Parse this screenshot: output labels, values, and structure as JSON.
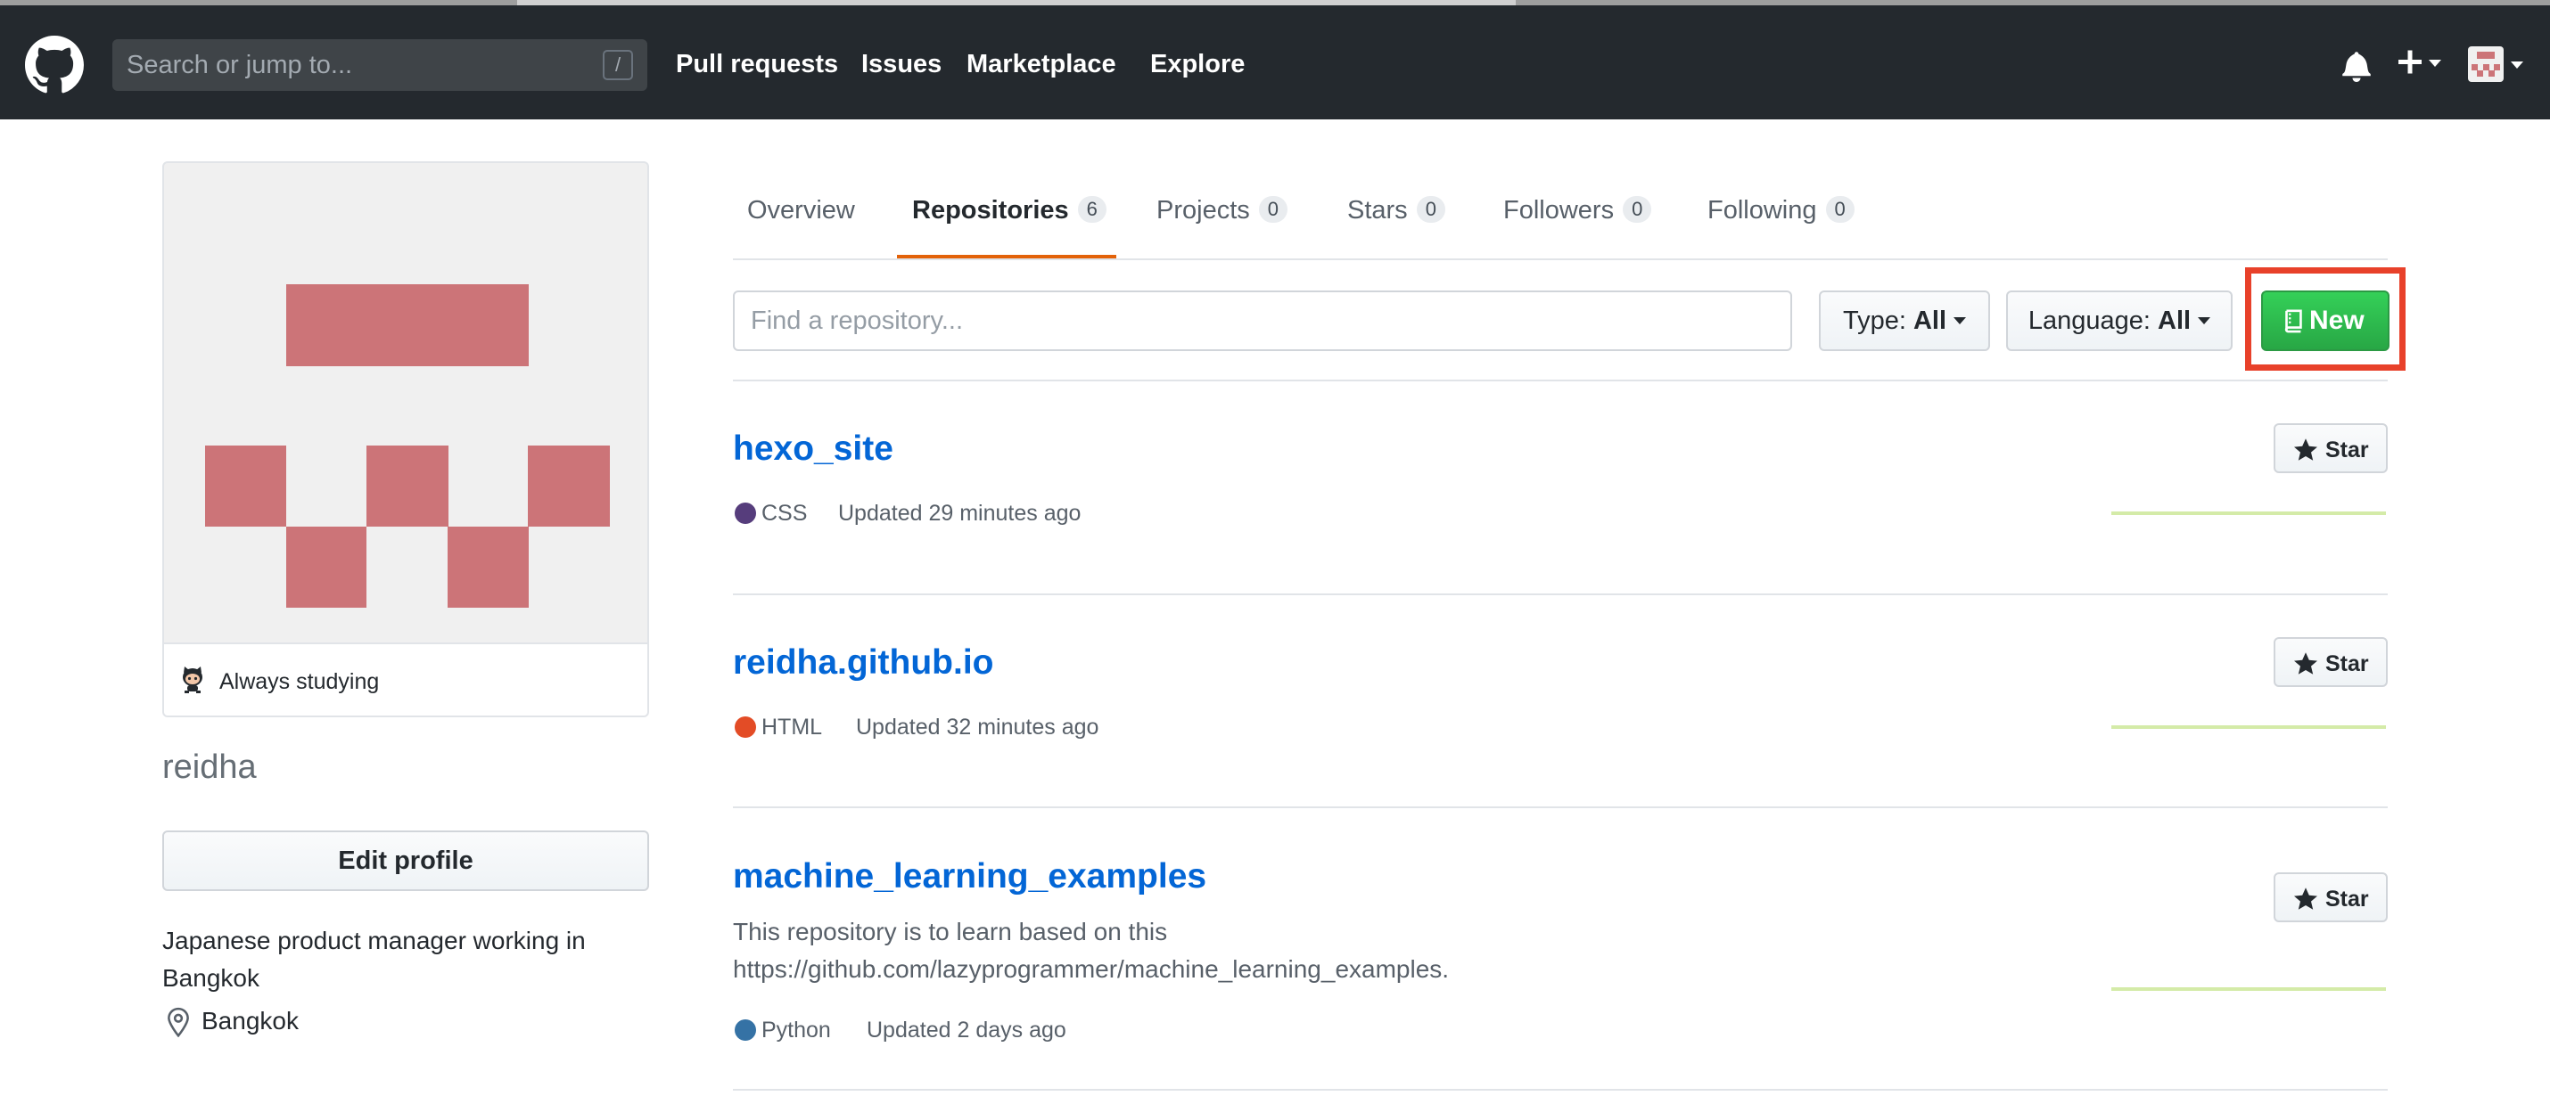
{
  "header": {
    "search_placeholder": "Search or jump to...",
    "search_shortcut": "/",
    "nav": [
      "Pull requests",
      "Issues",
      "Marketplace",
      "Explore"
    ]
  },
  "profile": {
    "status": "Always studying",
    "username": "reidha",
    "edit_profile_label": "Edit profile",
    "bio": "Japanese product manager working in Bangkok",
    "location": "Bangkok",
    "avatar_color": "#cc7478"
  },
  "tabs": [
    {
      "label": "Overview",
      "count": ""
    },
    {
      "label": "Repositories",
      "count": "6"
    },
    {
      "label": "Projects",
      "count": "0"
    },
    {
      "label": "Stars",
      "count": "0"
    },
    {
      "label": "Followers",
      "count": "0"
    },
    {
      "label": "Following",
      "count": "0"
    }
  ],
  "filters": {
    "find_placeholder": "Find a repository...",
    "type_label": "Type:",
    "type_value": "All",
    "language_label": "Language:",
    "language_value": "All",
    "new_label": "New"
  },
  "repos": [
    {
      "name": "hexo_site",
      "description": "",
      "language": "CSS",
      "language_color": "#563d7c",
      "updated": "Updated 29 minutes ago",
      "star_label": "Star"
    },
    {
      "name": "reidha.github.io",
      "description": "",
      "language": "HTML",
      "language_color": "#e34c26",
      "updated": "Updated 32 minutes ago",
      "star_label": "Star"
    },
    {
      "name": "machine_learning_examples",
      "description": "This repository is to learn based on this https://github.com/lazyprogrammer/machine_learning_examples.",
      "language": "Python",
      "language_color": "#3572a5",
      "updated": "Updated 2 days ago",
      "star_label": "Star"
    }
  ],
  "colors": {
    "header_bg": "#24292e",
    "link": "#0366d6",
    "new_button": "#28a745",
    "highlight_box": "#e8412a",
    "tab_underline": "#e36209"
  }
}
